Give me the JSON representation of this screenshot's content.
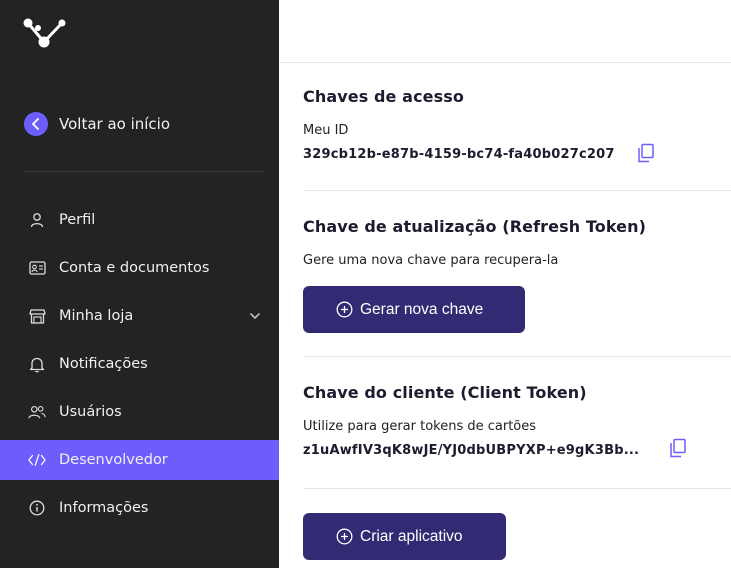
{
  "sidebar": {
    "back_label": "Voltar ao início",
    "items": [
      {
        "label": "Perfil",
        "icon": "user-icon"
      },
      {
        "label": "Conta e documentos",
        "icon": "id-card-icon"
      },
      {
        "label": "Minha loja",
        "icon": "store-icon"
      },
      {
        "label": "Notificações",
        "icon": "bell-icon"
      },
      {
        "label": "Usuários",
        "icon": "users-icon"
      },
      {
        "label": "Desenvolvedor",
        "icon": "code-icon",
        "active": true
      },
      {
        "label": "Informações",
        "icon": "info-icon"
      }
    ]
  },
  "access_keys": {
    "title": "Chaves de acesso",
    "id_label": "Meu ID",
    "id_value": "329cb12b-e87b-4159-bc74-fa40b027c207"
  },
  "refresh_token": {
    "title": "Chave de atualização (Refresh Token)",
    "description": "Gere uma nova chave para recupera-la",
    "button_label": "Gerar nova chave"
  },
  "client_token": {
    "title": "Chave do cliente (Client Token)",
    "description": "Utilize para gerar tokens de cartões",
    "value": "z1uAwfIV3qK8wJE/YJ0dbUBPYXP+e9gK3Bb..."
  },
  "create_app": {
    "button_label": "Criar aplicativo"
  },
  "colors": {
    "sidebar_bg": "#232323",
    "accent": "#6d5efc",
    "button_bg": "#332a74"
  }
}
